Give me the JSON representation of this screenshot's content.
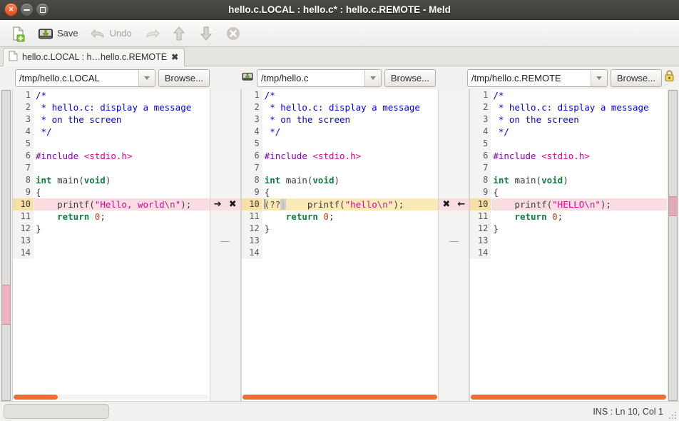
{
  "window": {
    "title": "hello.c.LOCAL : hello.c* : hello.c.REMOTE - Meld",
    "controls": {
      "close": "close-button",
      "minimize": "minimize-button",
      "maximize": "maximize-button"
    }
  },
  "toolbar": {
    "new_label": "",
    "save_label": "Save",
    "undo_label": "Undo",
    "redo_label": "",
    "up_label": "",
    "down_label": "",
    "stop_label": ""
  },
  "tab": {
    "label": "hello.c.LOCAL : h…hello.c.REMOTE",
    "close": "✖"
  },
  "paths": [
    {
      "value": "/tmp/hello.c.LOCAL",
      "browse": "Browse..."
    },
    {
      "value": "/tmp/hello.c",
      "browse": "Browse..."
    },
    {
      "value": "/tmp/hello.c.REMOTE",
      "browse": "Browse..."
    }
  ],
  "panes": [
    {
      "name": "local",
      "lines": [
        {
          "n": "1",
          "tokens": [
            {
              "t": "/*",
              "c": "c-com"
            }
          ]
        },
        {
          "n": "2",
          "tokens": [
            {
              "t": " * hello.c: display a message",
              "c": "c-com"
            }
          ]
        },
        {
          "n": "3",
          "tokens": [
            {
              "t": " * on the screen",
              "c": "c-com"
            }
          ]
        },
        {
          "n": "4",
          "tokens": [
            {
              "t": " */",
              "c": "c-com"
            }
          ]
        },
        {
          "n": "5",
          "tokens": []
        },
        {
          "n": "6",
          "tokens": [
            {
              "t": "#include",
              "c": "c-pre"
            },
            {
              "t": " ",
              "c": "c-pun"
            },
            {
              "t": "<stdio.h>",
              "c": "c-inc"
            }
          ]
        },
        {
          "n": "7",
          "tokens": []
        },
        {
          "n": "8",
          "tokens": [
            {
              "t": "int",
              "c": "c-kw"
            },
            {
              "t": " main(",
              "c": "c-fn"
            },
            {
              "t": "void",
              "c": "c-kw"
            },
            {
              "t": ")",
              "c": "c-fn"
            }
          ]
        },
        {
          "n": "9",
          "tokens": [
            {
              "t": "{",
              "c": "c-pun"
            }
          ]
        },
        {
          "n": "10",
          "conflict": true,
          "tokens": [
            {
              "t": "    printf(",
              "c": "c-fn"
            },
            {
              "t": "\"Hello, world",
              "c": "c-str"
            },
            {
              "t": "\\n",
              "c": "c-esc"
            },
            {
              "t": "\"",
              "c": "c-str"
            },
            {
              "t": ");",
              "c": "c-fn"
            }
          ]
        },
        {
          "n": "11",
          "tokens": [
            {
              "t": "    ",
              "c": "c-fn"
            },
            {
              "t": "return",
              "c": "c-kw"
            },
            {
              "t": " ",
              "c": "c-fn"
            },
            {
              "t": "0",
              "c": "c-num"
            },
            {
              "t": ";",
              "c": "c-pun"
            }
          ]
        },
        {
          "n": "12",
          "tokens": [
            {
              "t": "}",
              "c": "c-pun"
            }
          ]
        },
        {
          "n": "13",
          "tokens": []
        },
        {
          "n": "14",
          "tokens": []
        }
      ]
    },
    {
      "name": "merged",
      "lines": [
        {
          "n": "1",
          "tokens": [
            {
              "t": "/*",
              "c": "c-com"
            }
          ]
        },
        {
          "n": "2",
          "tokens": [
            {
              "t": " * hello.c: display a message",
              "c": "c-com"
            }
          ]
        },
        {
          "n": "3",
          "tokens": [
            {
              "t": " * on the screen",
              "c": "c-com"
            }
          ]
        },
        {
          "n": "4",
          "tokens": [
            {
              "t": " */",
              "c": "c-com"
            }
          ]
        },
        {
          "n": "5",
          "tokens": []
        },
        {
          "n": "6",
          "tokens": [
            {
              "t": "#include",
              "c": "c-pre"
            },
            {
              "t": " ",
              "c": "c-pun"
            },
            {
              "t": "<stdio.h>",
              "c": "c-inc"
            }
          ]
        },
        {
          "n": "7",
          "tokens": []
        },
        {
          "n": "8",
          "tokens": [
            {
              "t": "int",
              "c": "c-kw"
            },
            {
              "t": " main(",
              "c": "c-fn"
            },
            {
              "t": "void",
              "c": "c-kw"
            },
            {
              "t": ")",
              "c": "c-fn"
            }
          ]
        },
        {
          "n": "9",
          "tokens": [
            {
              "t": "{",
              "c": "c-pun"
            }
          ]
        },
        {
          "n": "10",
          "conflict": true,
          "amber": true,
          "caret": true,
          "tokens": [
            {
              "t": "(??",
              "c": "c-conf"
            },
            {
              "t": ")",
              "c": "c-confp"
            },
            {
              "t": "    printf(",
              "c": "c-fn"
            },
            {
              "t": "\"hello",
              "c": "c-str"
            },
            {
              "t": "\\n",
              "c": "c-esc"
            },
            {
              "t": "\"",
              "c": "c-str"
            },
            {
              "t": ");",
              "c": "c-fn"
            }
          ]
        },
        {
          "n": "11",
          "tokens": [
            {
              "t": "    ",
              "c": "c-fn"
            },
            {
              "t": "return",
              "c": "c-kw"
            },
            {
              "t": " ",
              "c": "c-fn"
            },
            {
              "t": "0",
              "c": "c-num"
            },
            {
              "t": ";",
              "c": "c-pun"
            }
          ]
        },
        {
          "n": "12",
          "tokens": [
            {
              "t": "}",
              "c": "c-pun"
            }
          ]
        },
        {
          "n": "13",
          "tokens": []
        },
        {
          "n": "14",
          "tokens": []
        }
      ]
    },
    {
      "name": "remote",
      "lines": [
        {
          "n": "1",
          "tokens": [
            {
              "t": "/*",
              "c": "c-com"
            }
          ]
        },
        {
          "n": "2",
          "tokens": [
            {
              "t": " * hello.c: display a message",
              "c": "c-com"
            }
          ]
        },
        {
          "n": "3",
          "tokens": [
            {
              "t": " * on the screen",
              "c": "c-com"
            }
          ]
        },
        {
          "n": "4",
          "tokens": [
            {
              "t": " */",
              "c": "c-com"
            }
          ]
        },
        {
          "n": "5",
          "tokens": []
        },
        {
          "n": "6",
          "tokens": [
            {
              "t": "#include",
              "c": "c-pre"
            },
            {
              "t": " ",
              "c": "c-pun"
            },
            {
              "t": "<stdio.h>",
              "c": "c-inc"
            }
          ]
        },
        {
          "n": "7",
          "tokens": []
        },
        {
          "n": "8",
          "tokens": [
            {
              "t": "int",
              "c": "c-kw"
            },
            {
              "t": " main(",
              "c": "c-fn"
            },
            {
              "t": "void",
              "c": "c-kw"
            },
            {
              "t": ")",
              "c": "c-fn"
            }
          ]
        },
        {
          "n": "9",
          "tokens": [
            {
              "t": "{",
              "c": "c-pun"
            }
          ]
        },
        {
          "n": "10",
          "conflict": true,
          "tokens": [
            {
              "t": "    printf(",
              "c": "c-fn"
            },
            {
              "t": "\"HELLO",
              "c": "c-str"
            },
            {
              "t": "\\n",
              "c": "c-esc"
            },
            {
              "t": "\"",
              "c": "c-str"
            },
            {
              "t": ");",
              "c": "c-fn"
            }
          ]
        },
        {
          "n": "11",
          "tokens": [
            {
              "t": "    ",
              "c": "c-fn"
            },
            {
              "t": "return",
              "c": "c-kw"
            },
            {
              "t": " ",
              "c": "c-fn"
            },
            {
              "t": "0",
              "c": "c-num"
            },
            {
              "t": ";",
              "c": "c-pun"
            }
          ]
        },
        {
          "n": "12",
          "tokens": [
            {
              "t": "}",
              "c": "c-pun"
            }
          ]
        },
        {
          "n": "13",
          "tokens": []
        },
        {
          "n": "14",
          "tokens": []
        }
      ]
    }
  ],
  "gutters": {
    "left": {
      "push_icon": "➔",
      "delete_icon": "✖",
      "spacer_icon": "—"
    },
    "right": {
      "push_icon": "←",
      "delete_icon": "✖",
      "spacer_icon": "—"
    }
  },
  "status": {
    "text": "INS : Ln 10, Col 1"
  },
  "colors": {
    "conflict_pink": "#fadde3",
    "conflict_amber": "#fce9b8",
    "scrollbar_orange": "#eb7031",
    "titlebar": "#433f3b",
    "close_button": "#da4d17"
  }
}
